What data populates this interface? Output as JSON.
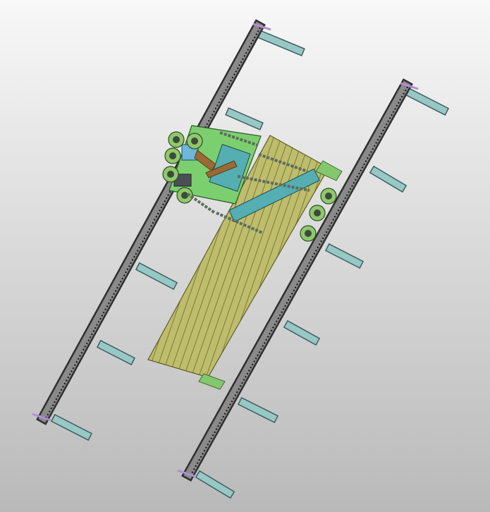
{
  "scene": {
    "colors": {
      "background_top": "#f8f8f8",
      "background_bottom": "#b9b9b9",
      "rail_steel": "#8a8a8a",
      "rail_dark": "#2f2f2f",
      "support_arm": "#97c8c6",
      "slat_bed": "#bebd6d",
      "slat_dark": "#7b7a32",
      "carriage_green": "#7ccf6f",
      "carriage_blue": "#55aeb1",
      "motor_blue": "#6eb7d8",
      "motor_dark": "#4a4f56",
      "bracket_brown": "#9a6a35",
      "end_plate": "#b58bd5",
      "roller_green": "#90c86b"
    },
    "icons": {
      "rail_left": "rail-beam-icon",
      "rail_right": "rail-beam-icon",
      "support_arm": "support-arm-icon",
      "slat_bed": "slat-bed-icon",
      "carriage": "carriage-assembly-icon",
      "motor": "motor-icon",
      "roller": "roller-wheel-icon",
      "chain": "chain-link-icon"
    }
  }
}
